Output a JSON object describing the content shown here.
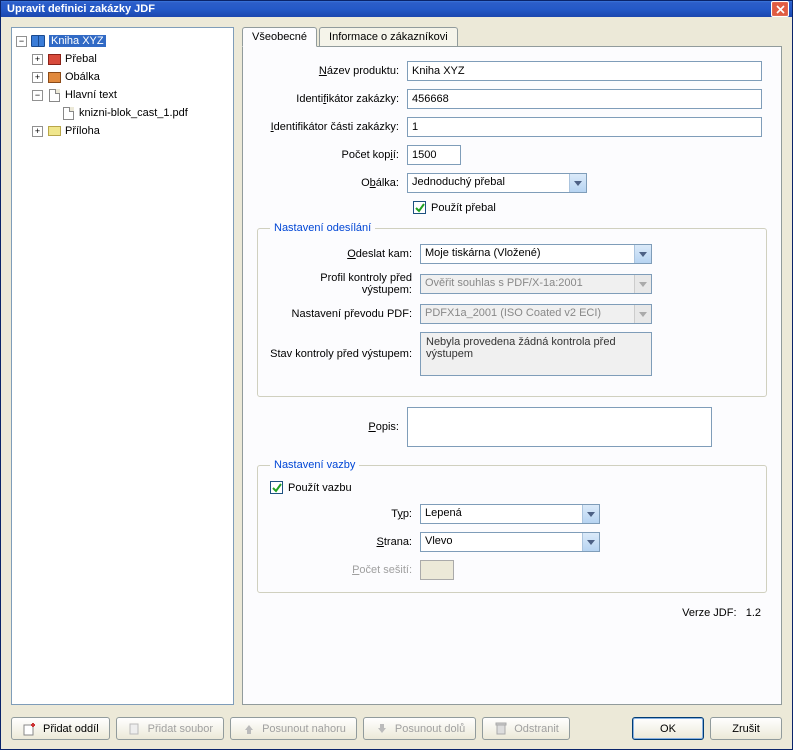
{
  "window": {
    "title": "Upravit definici zakázky JDF"
  },
  "tree": {
    "root": {
      "label": "Kniha XYZ"
    },
    "cover": {
      "label": "Přebal"
    },
    "jacket": {
      "label": "Obálka"
    },
    "maintext": {
      "label": "Hlavní text"
    },
    "file1": {
      "label": "knizni-blok_cast_1.pdf"
    },
    "appendix": {
      "label": "Příloha"
    }
  },
  "tabs": {
    "general": "Všeobecné",
    "customer": "Informace o zákazníkovi"
  },
  "form": {
    "product_name_label": "Název produktu:",
    "product_name_value": "Kniha XYZ",
    "job_id_label": "Identifikátor zakázky:",
    "job_id_value": "456668",
    "part_id_label": "Identifikátor části zakázky:",
    "part_id_value": "1",
    "copies_label": "Počet kopií:",
    "copies_value": "1500",
    "cover_label": "Obálka:",
    "cover_value": "Jednoduchý přebal",
    "use_cover_label": "Použít přebal",
    "desc_label": "Popis:"
  },
  "send": {
    "legend": "Nastavení odesílání",
    "dest_label": "Odeslat kam:",
    "dest_value": "Moje tiskárna (Vložené)",
    "preflight_label": "Profil kontroly před výstupem:",
    "preflight_value": "Ověřit souhlas s PDF/X-1a:2001",
    "pdf_label": "Nastavení převodu PDF:",
    "pdf_value": "PDFX1a_2001 (ISO Coated v2 ECI)",
    "status_label": "Stav kontroly před výstupem:",
    "status_value": "Nebyla provedena žádná kontrola před výstupem"
  },
  "binding": {
    "legend": "Nastavení vazby",
    "use_label": "Použít vazbu",
    "type_label": "Typ:",
    "type_value": "Lepená",
    "side_label": "Strana:",
    "side_value": "Vlevo",
    "stitch_label": "Počet sešití:"
  },
  "version": {
    "label": "Verze JDF:",
    "value": "1.2"
  },
  "buttons": {
    "add_section": "Přidat oddíl",
    "add_file": "Přidat soubor",
    "move_up": "Posunout nahoru",
    "move_down": "Posunout dolů",
    "delete": "Odstranit",
    "ok": "OK",
    "cancel": "Zrušit"
  }
}
